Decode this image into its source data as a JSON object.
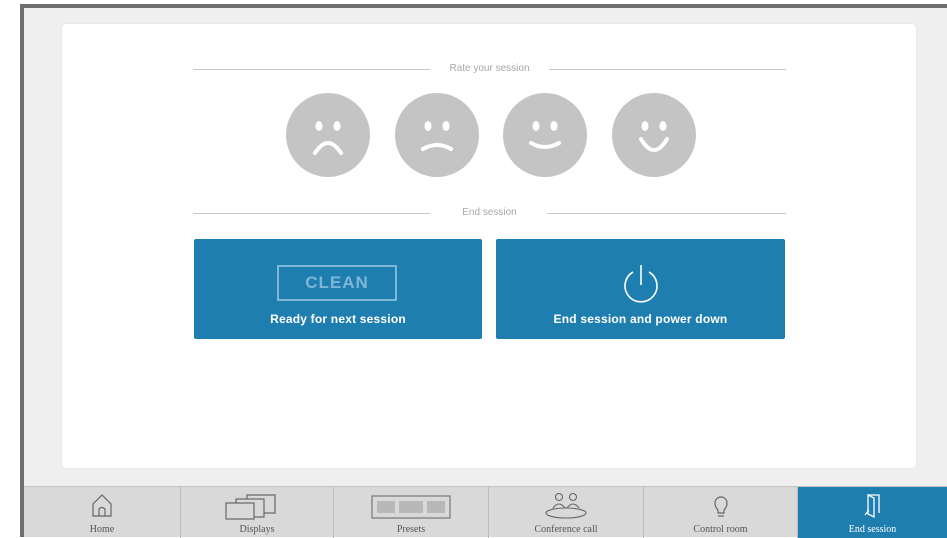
{
  "rating": {
    "heading": "Rate your session",
    "faces": [
      {
        "icon": "very-sad-face-icon"
      },
      {
        "icon": "sad-face-icon"
      },
      {
        "icon": "happy-face-icon"
      },
      {
        "icon": "very-happy-face-icon"
      }
    ]
  },
  "end_session": {
    "heading": "End session",
    "clean_button": {
      "badge": "CLEAN",
      "label": "Ready for next session"
    },
    "power_button": {
      "icon": "power-icon",
      "label": "End session and power down"
    }
  },
  "nav": {
    "items": [
      {
        "label": "Home",
        "icon": "home-icon"
      },
      {
        "label": "Displays",
        "icon": "displays-icon"
      },
      {
        "label": "Presets",
        "icon": "presets-icon"
      },
      {
        "label": "Conference call",
        "icon": "conference-call-icon"
      },
      {
        "label": "Control room",
        "icon": "lightbulb-icon"
      },
      {
        "label": "End session",
        "icon": "door-exit-icon"
      }
    ],
    "active": "End session"
  },
  "colors": {
    "accent": "#1e7eb0",
    "face_gray": "#c4c4c4",
    "nav_bg": "#d9d9d9"
  }
}
